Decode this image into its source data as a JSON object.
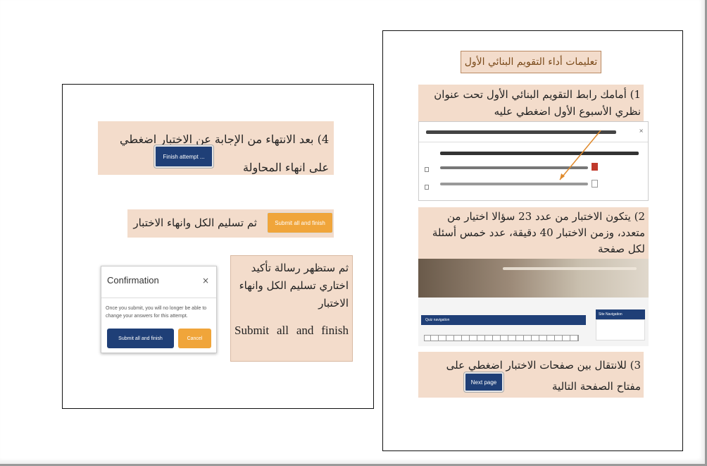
{
  "title": "تعليمات أداء التقويم البنائي الأول",
  "step1": {
    "text": "1) أمامك رابط التقويم البنائي الأول تحت عنوان نظري الأسبوع الأول اضغطي عليه"
  },
  "step2": {
    "text": "2) يتكون الاختبار من عدد 23 سؤالا اختيار من متعدد، وزمن الاختبار 40 دقيقة، عدد خمس أسئلة لكل صفحة",
    "quiz_nav_label": "Quiz navigation",
    "site_nav_label": "Site Navigation"
  },
  "step3": {
    "text": "3) للانتقال بين صفحات الاختبار اضغطي على مفتاح الصفحة التالية",
    "button": "Next page"
  },
  "step4": {
    "text": "4) بعد الانتهاء من الإجابة عن الاختبار اضغطي على انهاء المحاولة",
    "button": "Finish attempt ..."
  },
  "step5": {
    "text": "ثم تسليم الكل وانهاء الاختبار",
    "button": "Submit all and finish"
  },
  "step6": {
    "text": "ثم ستظهر رسالة تأكيد اختاري تسليم الكل وانهاء الاختبار",
    "english": "Submit all and finish"
  },
  "dialog": {
    "title": "Confirmation",
    "close": "×",
    "message": "Once you submit, you will no longer be able to change your answers for this attempt.",
    "submit": "Submit all and finish",
    "cancel": "Cancel"
  },
  "colors": {
    "navy": "#1f3f77",
    "orange": "#f0a53a",
    "beige": "#f3dccb",
    "title_text": "#7a4a1a"
  }
}
